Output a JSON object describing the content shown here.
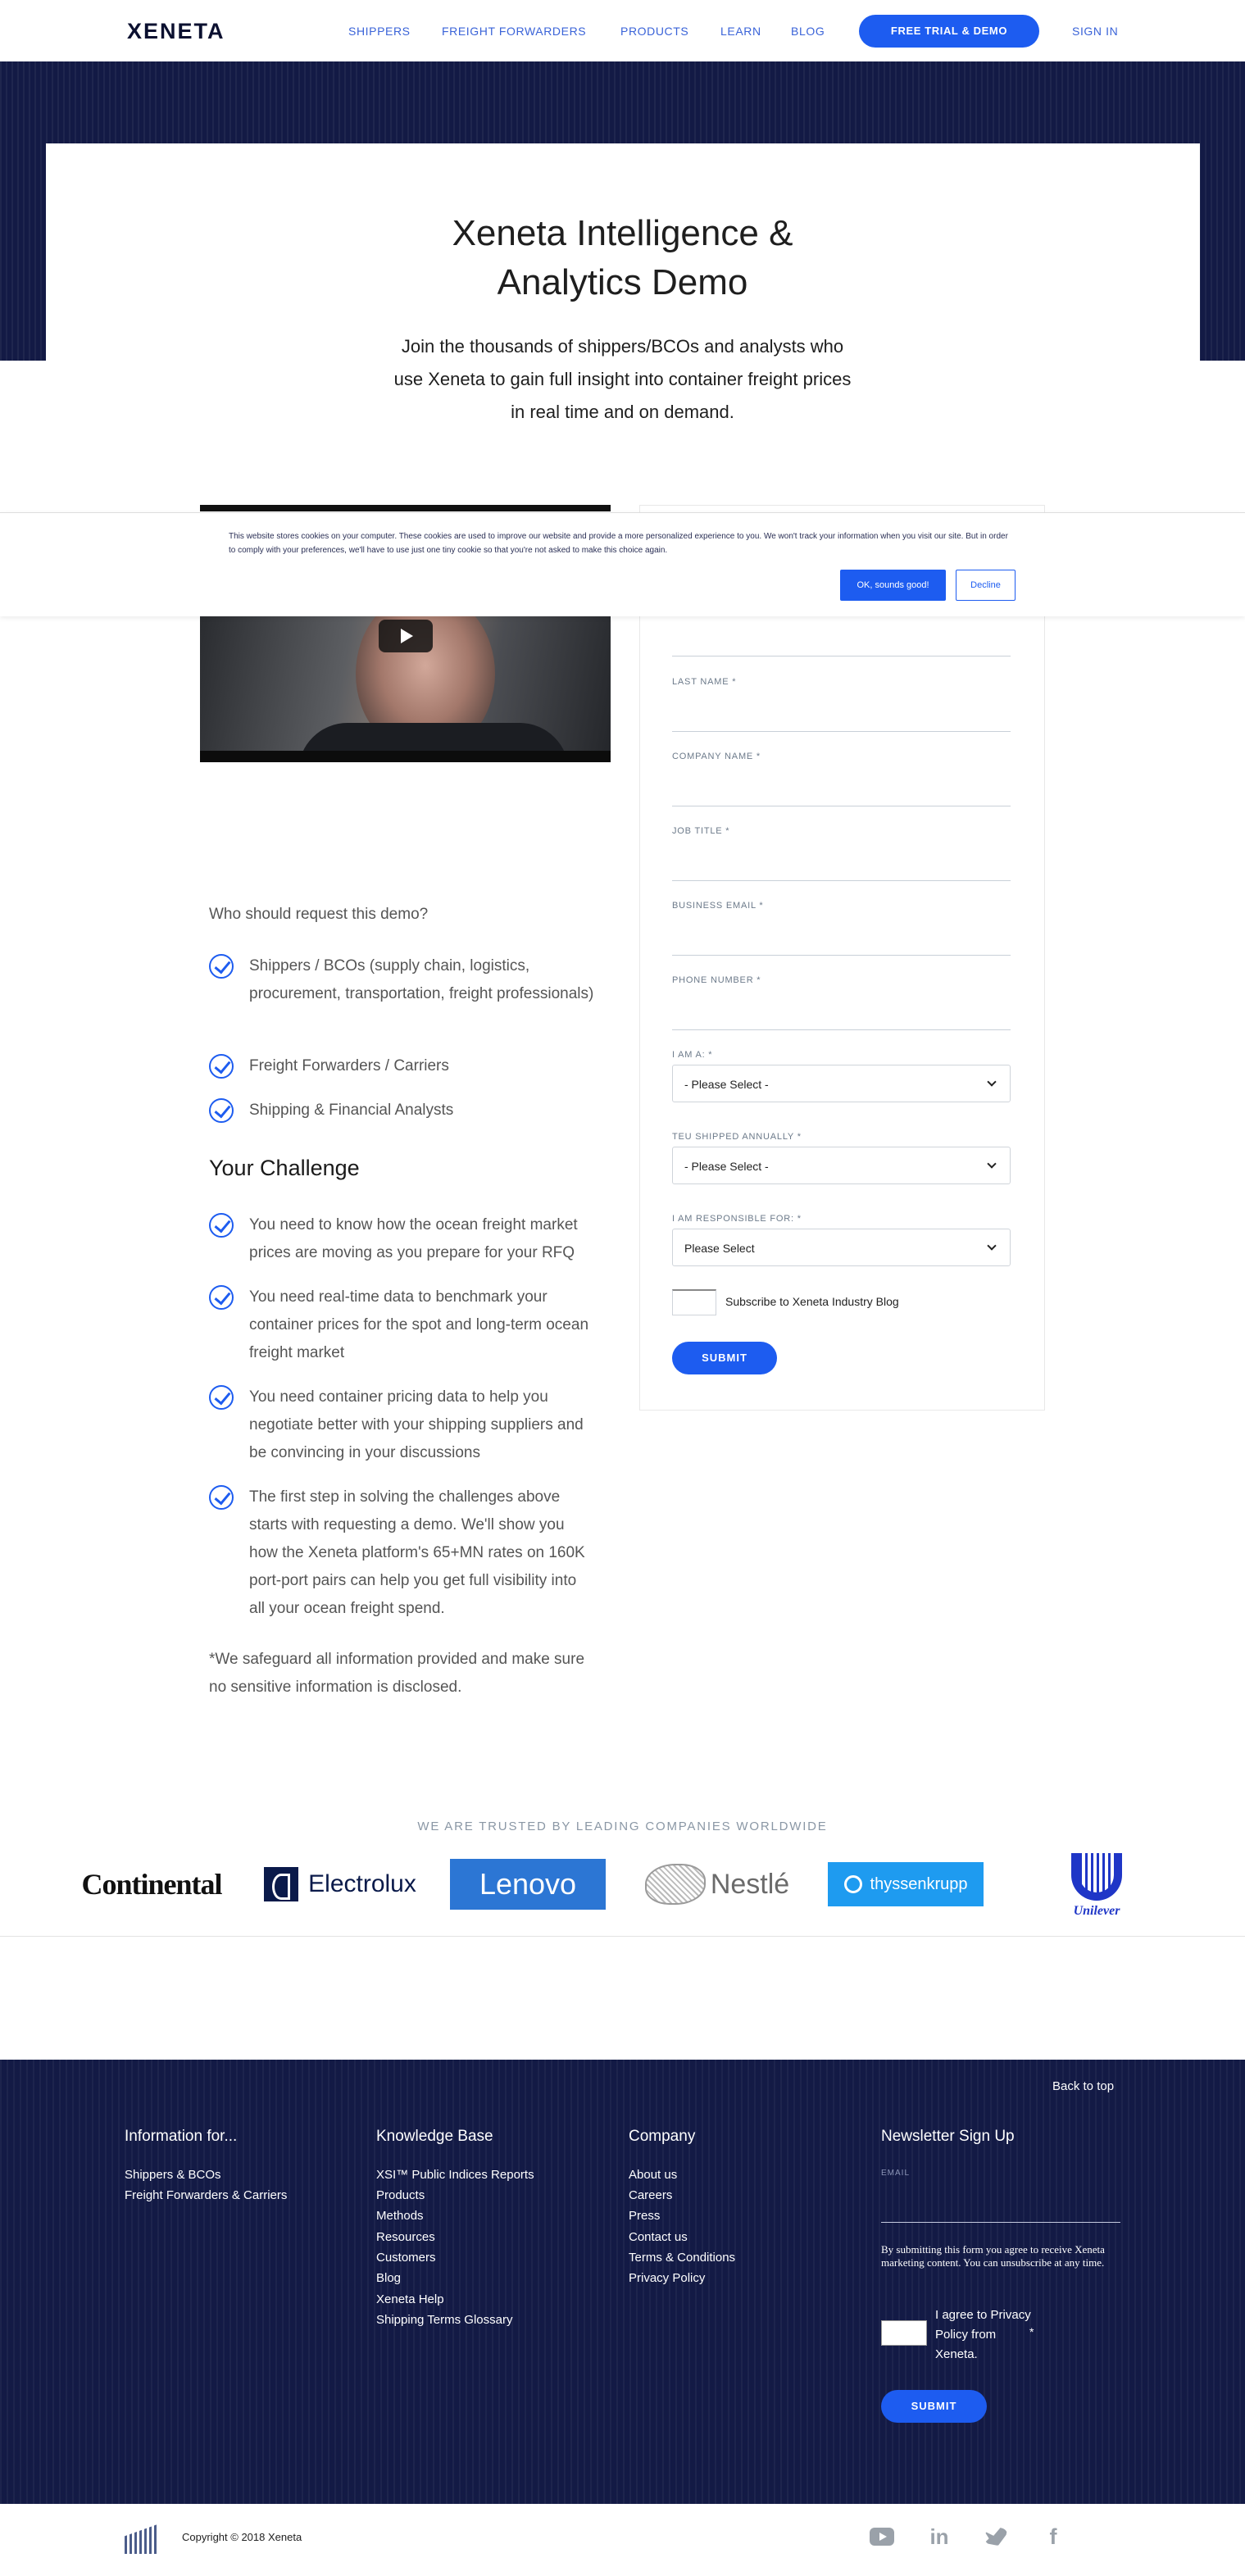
{
  "nav": {
    "logo": "XENETA",
    "links": [
      "SHIPPERS",
      "FREIGHT FORWARDERS",
      "PRODUCTS",
      "LEARN",
      "BLOG"
    ],
    "trial_button": "FREE TRIAL & DEMO",
    "sign_in": "SIGN IN"
  },
  "hero": {
    "title_line1": "Xeneta Intelligence &",
    "title_line2": "Analytics Demo",
    "subtitle_line1": "Join the thousands of shippers/BCOs and analysts who",
    "subtitle_line2": "use Xeneta to gain full insight into container freight prices",
    "subtitle_line3": "in real time and on demand."
  },
  "cookie": {
    "text": "This website stores cookies on your computer. These cookies are used to improve our website and provide a more personalized experience to you. We won't track your information when you visit our site. But in order to comply with your preferences, we'll have to use just one tiny cookie so that you're not asked to make this choice again.",
    "accept": "OK, sounds good!",
    "decline": "Decline"
  },
  "form": {
    "last_name": "LAST NAME *",
    "company_name": "COMPANY NAME *",
    "job_title": "JOB TITLE *",
    "business_email": "BUSINESS EMAIL *",
    "phone_number": "PHONE NUMBER *",
    "i_am_a": "I AM A: *",
    "i_am_a_value": "- Please Select -",
    "teu_label": "TEU SHIPPED ANNUALLY *",
    "teu_value": "- Please Select -",
    "responsible_label": "I AM RESPONSIBLE FOR: *",
    "responsible_value": "Please Select",
    "subscribe_label": "Subscribe to Xeneta Industry Blog",
    "submit": "SUBMIT"
  },
  "content": {
    "who_heading": "Who should request this demo?",
    "who_items": [
      "Shippers / BCOs (supply chain,  logistics, procurement, transportation, freight professionals)",
      "Freight Forwarders / Carriers",
      "Shipping & Financial Analysts"
    ],
    "challenge_heading": "Your Challenge",
    "challenge_items": [
      "You need to know how the ocean freight market prices are moving as you prepare for your RFQ",
      "You need real-time data to benchmark your container prices for the spot and long-term ocean freight market",
      "You need container pricing data to help you negotiate better with your shipping suppliers and be convincing in your discussions",
      "The first step in solving the challenges above starts with requesting a demo.  We'll show you how the Xeneta platform's 65+MN rates on 160K port-port pairs can help you get full visibility into all your ocean freight spend."
    ],
    "safeguard": " *We safeguard all information provided and make sure no sensitive information is disclosed."
  },
  "trusted": {
    "heading": "WE ARE TRUSTED BY LEADING COMPANIES WORLDWIDE",
    "brands": [
      "Continental",
      "Electrolux",
      "Lenovo",
      "Nestlé",
      "thyssenkrupp",
      "Unilever"
    ]
  },
  "footer": {
    "back_to_top": "Back to top",
    "col1_heading": "Information for...",
    "col1_links": [
      "Shippers & BCOs",
      "Freight Forwarders & Carriers"
    ],
    "col2_heading": "Knowledge Base",
    "col2_links": [
      "XSI™ Public Indices Reports",
      "Products",
      "Methods",
      "Resources",
      "Customers",
      "Blog",
      "Xeneta Help",
      "Shipping Terms Glossary"
    ],
    "col3_heading": "Company",
    "col3_links": [
      "About us",
      "Careers",
      "Press",
      "Contact us",
      "Terms & Conditions",
      "Privacy Policy"
    ],
    "newsletter_heading": "Newsletter Sign Up",
    "email_label": "EMAIL",
    "note": "By submitting this form you agree to receive Xeneta marketing content. You can unsubscribe at any time.",
    "agree_text": "I agree to Privacy Policy from Xeneta.",
    "agree_star": "*",
    "submit": "SUBMIT"
  },
  "bottom": {
    "copyright": "Copyright © 2018 Xeneta",
    "social": [
      "youtube-icon",
      "linkedin-icon",
      "twitter-icon",
      "facebook-icon"
    ]
  },
  "colors": {
    "accent": "#1d5cf0",
    "navy": "#131a45"
  }
}
